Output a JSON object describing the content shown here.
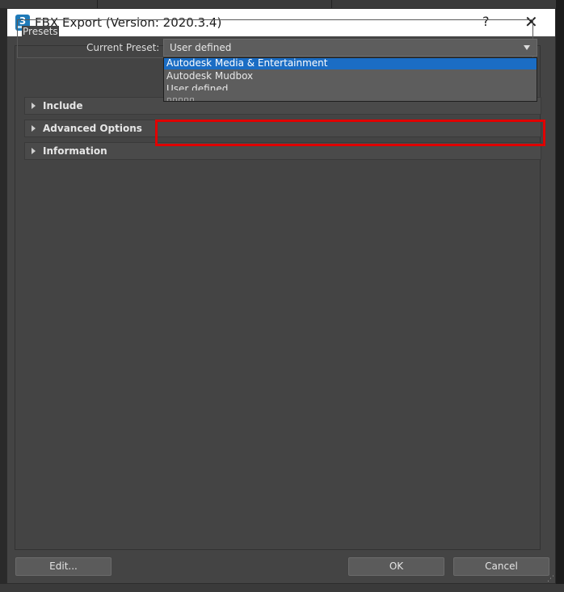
{
  "window": {
    "title": "FBX Export (Version: 2020.3.4)",
    "help_label": "?",
    "close_label": "✕",
    "icon_text": "3"
  },
  "presets": {
    "legend": "Presets",
    "current_label": "Current Preset:",
    "current_value": "User defined",
    "options": [
      {
        "label": "Autodesk Media & Entertainment",
        "selected": true
      },
      {
        "label": "Autodesk Mudbox",
        "selected": false
      },
      {
        "label": "User defined",
        "selected": false
      },
      {
        "label": "▫▫▫▫▫",
        "selected": false
      }
    ]
  },
  "sections": [
    {
      "label": "Include"
    },
    {
      "label": "Advanced Options"
    },
    {
      "label": "Information"
    }
  ],
  "footer": {
    "edit_label": "Edit...",
    "ok_label": "OK",
    "cancel_label": "Cancel"
  },
  "colors": {
    "dialog_bg": "#444444",
    "selection": "#1b6dc4",
    "highlight_box": "#e00000"
  }
}
